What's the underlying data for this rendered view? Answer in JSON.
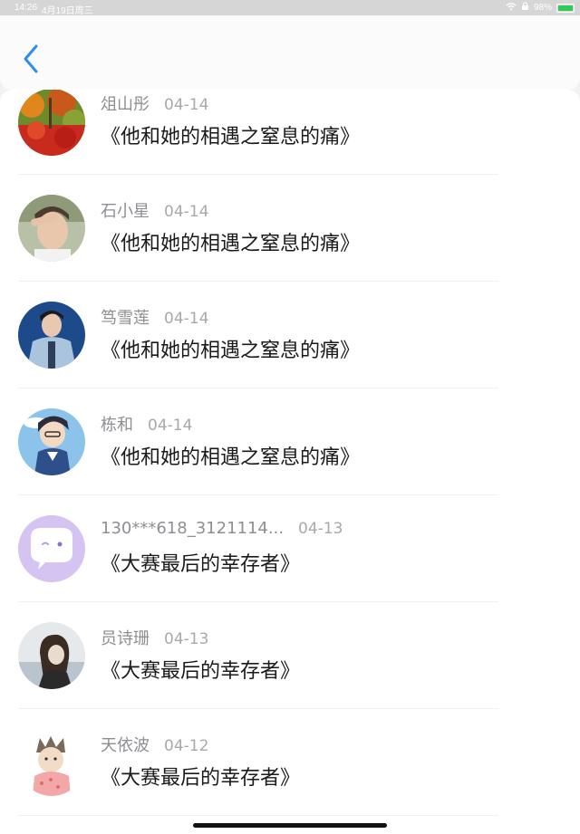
{
  "status_bar": {
    "time": "14:26",
    "date": "4月19日周三",
    "battery": "98%",
    "battery_level": 0.98
  },
  "header": {
    "back_icon": "chevron-left-icon",
    "accent": "#2f8cf0"
  },
  "list": [
    {
      "name": "俎山彤",
      "date": "04-14",
      "title": "《他和她的相遇之窒息的痛》"
    },
    {
      "name": "石小星",
      "date": "04-14",
      "title": "《他和她的相遇之窒息的痛》"
    },
    {
      "name": "笃雪莲",
      "date": "04-14",
      "title": "《他和她的相遇之窒息的痛》"
    },
    {
      "name": "栋和",
      "date": "04-14",
      "title": "《他和她的相遇之窒息的痛》"
    },
    {
      "name": "130***618_3121114...",
      "date": "04-13",
      "title": "《大赛最后的幸存者》"
    },
    {
      "name": "员诗珊",
      "date": "04-13",
      "title": "《大赛最后的幸存者》"
    },
    {
      "name": "天依波",
      "date": "04-12",
      "title": "《大赛最后的幸存者》"
    }
  ]
}
